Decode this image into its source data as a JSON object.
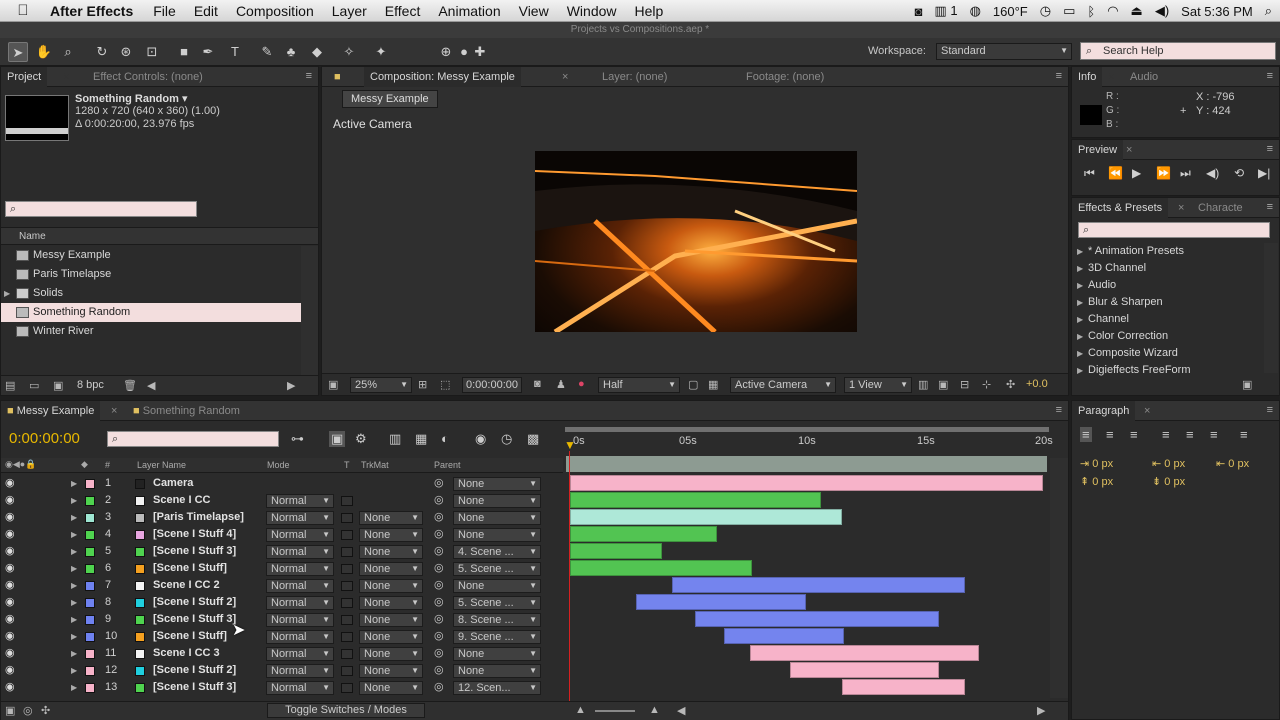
{
  "menubar": {
    "apple": "",
    "app": "After Effects",
    "items": [
      "File",
      "Edit",
      "Composition",
      "Layer",
      "Effect",
      "Animation",
      "View",
      "Window",
      "Help"
    ],
    "status": {
      "display_count": "1",
      "temperature": "160°F",
      "clock": "Sat 5:36 PM"
    }
  },
  "window_title": "Projects vs Compositions.aep *",
  "toolbar": {
    "workspace_label": "Workspace:",
    "workspace_value": "Standard",
    "search_placeholder": "Search Help"
  },
  "project_panel": {
    "tabs": [
      "Project",
      "Effect Controls: (none)"
    ],
    "preview": {
      "name": "Something Random ▾",
      "line1": "1280 x 720  (640 x 360) (1.00)",
      "line2": "Δ 0:00:20:00, 23.976 fps"
    },
    "column_name": "Name",
    "items": [
      {
        "label": "Messy Example",
        "type": "comp"
      },
      {
        "label": "Paris Timelapse",
        "type": "comp"
      },
      {
        "label": "Solids",
        "type": "folder"
      },
      {
        "label": "Something Random",
        "type": "comp",
        "selected": true
      },
      {
        "label": "Winter River",
        "type": "comp"
      }
    ],
    "footer_bpc": "8 bpc"
  },
  "comp_panel": {
    "tabs": [
      "Composition: Messy Example",
      "Layer: (none)",
      "Footage: (none)"
    ],
    "breadcrumb": "Messy Example",
    "camera_label": "Active Camera",
    "footer": {
      "zoom": "25%",
      "timecode": "0:00:00:00",
      "resolution": "Half",
      "camera": "Active Camera",
      "views": "1 View",
      "exposure": "+0.0"
    }
  },
  "info_panel": {
    "tabs": [
      "Info",
      "Audio"
    ],
    "r": "R :",
    "g": "G :",
    "b": "B :",
    "x": "X : -796",
    "y": "Y : 424"
  },
  "preview_panel": {
    "tab": "Preview"
  },
  "effects_panel": {
    "tabs": [
      "Effects & Presets",
      "Characte"
    ],
    "items": [
      "* Animation Presets",
      "3D Channel",
      "Audio",
      "Blur & Sharpen",
      "Channel",
      "Color Correction",
      "Composite Wizard",
      "Digieffects FreeForm"
    ]
  },
  "paragraph_panel": {
    "tab": "Paragraph",
    "fields": [
      "0 px",
      "0 px",
      "0 px",
      "0 px",
      "0 px"
    ]
  },
  "timeline": {
    "tabs": [
      "Messy Example",
      "Something Random"
    ],
    "timecode": "0:00:00:00",
    "columns": {
      "num": "#",
      "layer": "Layer Name",
      "mode": "Mode",
      "t": "T",
      "trkmat": "TrkMat",
      "parent": "Parent"
    },
    "ruler": [
      "0s",
      "05s",
      "10s",
      "15s",
      "20s"
    ],
    "footer_label": "Toggle Switches / Modes",
    "layers": [
      {
        "num": "1",
        "name": "Camera",
        "label": "#f7b3c9",
        "icon": "camera",
        "mode": "",
        "trkmat": "",
        "parent": "None",
        "bar": {
          "start": 0,
          "end": 20
        },
        "barcolor": "#f7b3c9"
      },
      {
        "num": "2",
        "name": "Scene I CC",
        "label": "#4fd34f",
        "icon": "solid",
        "mode": "Normal",
        "trkmat": "",
        "parent": "None",
        "bar": {
          "start": 0,
          "end": 10.6
        },
        "barcolor": "#52c452"
      },
      {
        "num": "3",
        "name": "[Paris Timelapse]",
        "label": "#9ee6d2",
        "icon": "comp",
        "mode": "Normal",
        "trkmat": "None",
        "parent": "None",
        "bar": {
          "start": 0,
          "end": 11.5
        },
        "barcolor": "#aee8d8"
      },
      {
        "num": "4",
        "name": "[Scene I Stuff 4]",
        "label": "#4fd34f",
        "icon": "pink",
        "mode": "Normal",
        "trkmat": "None",
        "parent": "None",
        "bar": {
          "start": 0,
          "end": 6.2
        },
        "barcolor": "#52c452"
      },
      {
        "num": "5",
        "name": "[Scene I Stuff 3]",
        "label": "#4fd34f",
        "icon": "green",
        "mode": "Normal",
        "trkmat": "None",
        "parent": "4. Scene ...",
        "bar": {
          "start": 0,
          "end": 3.9
        },
        "barcolor": "#52c452"
      },
      {
        "num": "6",
        "name": "[Scene I Stuff]",
        "label": "#4fd34f",
        "icon": "orange",
        "mode": "Normal",
        "trkmat": "None",
        "parent": "5. Scene ...",
        "bar": {
          "start": 0,
          "end": 7.7
        },
        "barcolor": "#52c452"
      },
      {
        "num": "7",
        "name": "Scene I CC 2",
        "label": "#6f82f0",
        "icon": "solid",
        "mode": "Normal",
        "trkmat": "None",
        "parent": "None",
        "bar": {
          "start": 4.3,
          "end": 16.7
        },
        "barcolor": "#7484ee"
      },
      {
        "num": "8",
        "name": "[Scene I Stuff 2]",
        "label": "#6f82f0",
        "icon": "cyan",
        "mode": "Normal",
        "trkmat": "None",
        "parent": "5. Scene ...",
        "bar": {
          "start": 2.8,
          "end": 10
        },
        "barcolor": "#7484ee"
      },
      {
        "num": "9",
        "name": "[Scene I Stuff 3]",
        "label": "#6f82f0",
        "icon": "green",
        "mode": "Normal",
        "trkmat": "None",
        "parent": "8. Scene ...",
        "bar": {
          "start": 5.3,
          "end": 15.6
        },
        "barcolor": "#7484ee"
      },
      {
        "num": "10",
        "name": "[Scene I Stuff]",
        "label": "#6f82f0",
        "icon": "orange",
        "mode": "Normal",
        "trkmat": "None",
        "parent": "9. Scene ...",
        "bar": {
          "start": 6.5,
          "end": 11.6
        },
        "barcolor": "#7484ee"
      },
      {
        "num": "11",
        "name": "Scene I CC 3",
        "label": "#f7b3c9",
        "icon": "solid",
        "mode": "Normal",
        "trkmat": "None",
        "parent": "None",
        "bar": {
          "start": 7.6,
          "end": 17.3
        },
        "barcolor": "#f7b3c9"
      },
      {
        "num": "12",
        "name": "[Scene I Stuff 2]",
        "label": "#f7b3c9",
        "icon": "cyan",
        "mode": "Normal",
        "trkmat": "None",
        "parent": "None",
        "bar": {
          "start": 9.3,
          "end": 15.6
        },
        "barcolor": "#f7b3c9"
      },
      {
        "num": "13",
        "name": "[Scene I Stuff 3]",
        "label": "#f7b3c9",
        "icon": "green",
        "mode": "Normal",
        "trkmat": "None",
        "parent": "12. Scen...",
        "bar": {
          "start": 11.5,
          "end": 16.7
        },
        "barcolor": "#f7b3c9"
      }
    ]
  }
}
